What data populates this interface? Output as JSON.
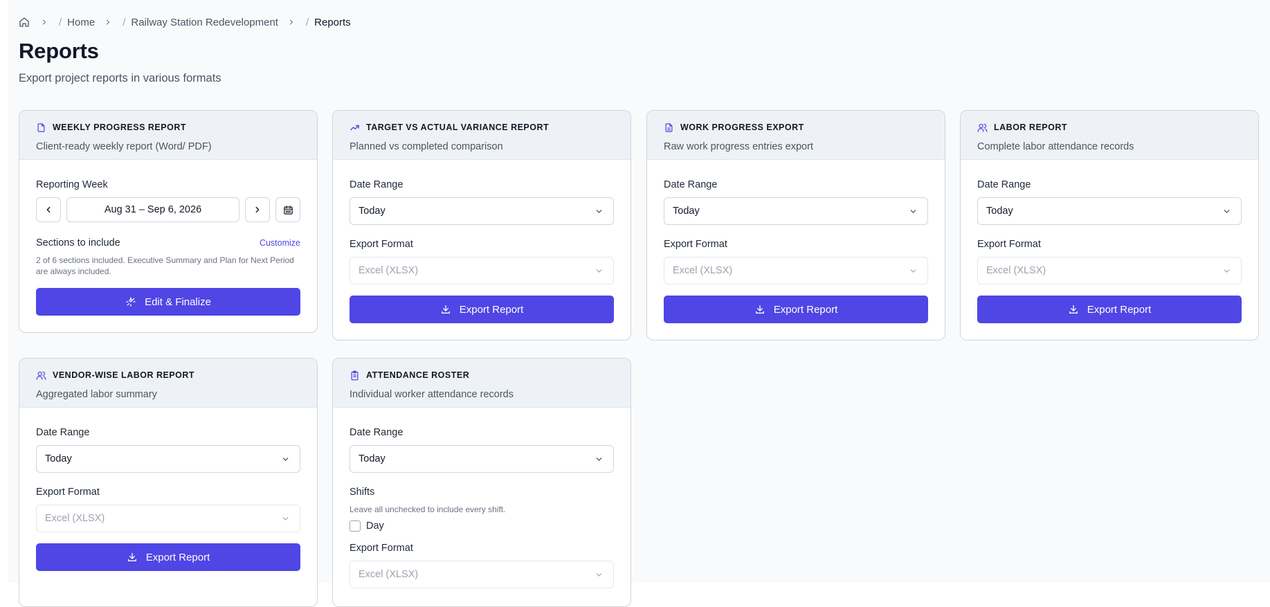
{
  "breadcrumb": {
    "items": [
      "Home",
      "Railway Station Redevelopment",
      "Reports"
    ]
  },
  "header": {
    "title": "Reports",
    "subtitle": "Export project reports in various formats"
  },
  "colors": {
    "accent": "#4f46e5",
    "card_head_bg": "#eef2f6",
    "page_bg": "#f8fafc"
  },
  "cards": [
    {
      "icon": "document-icon",
      "title": "WEEKLY PROGRESS REPORT",
      "description": "Client-ready weekly report (Word/ PDF)",
      "week_label": "Reporting Week",
      "week_value": "Aug 31 – Sep 6, 2026",
      "sections_label": "Sections to include",
      "customize_label": "Customize",
      "sections_hint": "2 of 6 sections included. Executive Summary and Plan for Next Period are always included.",
      "button_label": "Edit & Finalize"
    },
    {
      "icon": "trending-up-icon",
      "title": "TARGET VS ACTUAL VARIANCE REPORT",
      "description": "Planned vs completed comparison",
      "date_label": "Date Range",
      "date_value": "Today",
      "format_label": "Export Format",
      "format_value": "Excel (XLSX)",
      "button_label": "Export Report"
    },
    {
      "icon": "file-text-icon",
      "title": "WORK PROGRESS EXPORT",
      "description": "Raw work progress entries export",
      "date_label": "Date Range",
      "date_value": "Today",
      "format_label": "Export Format",
      "format_value": "Excel (XLSX)",
      "button_label": "Export Report"
    },
    {
      "icon": "users-icon",
      "title": "LABOR REPORT",
      "description": "Complete labor attendance records",
      "date_label": "Date Range",
      "date_value": "Today",
      "format_label": "Export Format",
      "format_value": "Excel (XLSX)",
      "button_label": "Export Report"
    },
    {
      "icon": "users-icon",
      "title": "VENDOR-WISE LABOR REPORT",
      "description": "Aggregated labor summary",
      "date_label": "Date Range",
      "date_value": "Today",
      "format_label": "Export Format",
      "format_value": "Excel (XLSX)",
      "button_label": "Export Report"
    },
    {
      "icon": "clipboard-list-icon",
      "title": "ATTENDANCE ROSTER",
      "description": "Individual worker attendance records",
      "date_label": "Date Range",
      "date_value": "Today",
      "shifts_label": "Shifts",
      "shifts_hint": "Leave all unchecked to include every shift.",
      "shift_option": "Day",
      "format_label": "Export Format",
      "format_value": "Excel (XLSX)"
    }
  ]
}
